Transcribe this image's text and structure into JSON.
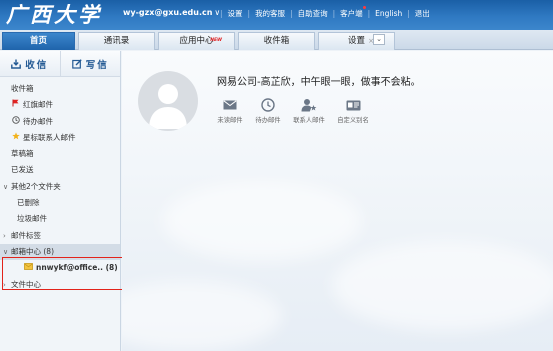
{
  "header": {
    "logo_text": "广西大学",
    "account": "wy-gzx@gxu.edu.cn",
    "account_caret": "∨",
    "links": [
      "设置",
      "我的客服",
      "自助查询",
      "客户端",
      "English",
      "退出"
    ]
  },
  "tabs": [
    {
      "label": "首页",
      "active": true
    },
    {
      "label": "通讯录"
    },
    {
      "label": "应用中心",
      "badge": "NEW"
    },
    {
      "label": "收件箱"
    },
    {
      "label": "设置",
      "close": "×"
    }
  ],
  "sidebar": {
    "receive_label": "收信",
    "compose_label": "写信",
    "items": [
      {
        "label": "收件箱"
      },
      {
        "label": "红旗邮件",
        "icon": "flag-icon"
      },
      {
        "label": "待办邮件",
        "icon": "clock-icon"
      },
      {
        "label": "星标联系人邮件",
        "icon": "star-icon"
      },
      {
        "label": "草稿箱"
      },
      {
        "label": "已发送"
      },
      {
        "label": "其他2个文件夹",
        "chevron": "∨"
      },
      {
        "label": "已删除"
      },
      {
        "label": "垃圾邮件"
      },
      {
        "label": "邮件标签",
        "chevron": "›"
      },
      {
        "label": "邮箱中心 (8)",
        "chevron": "∨"
      },
      {
        "label": "nnwykf@office.. (8)",
        "icon": "mailbox-icon"
      },
      {
        "label": "文件中心",
        "chevron": "›"
      }
    ]
  },
  "main": {
    "greeting": "网易公司-高芷欣，中午眼一眼，做事不会粘。",
    "quick_actions": [
      {
        "label": "未读邮件",
        "icon": "envelope-icon"
      },
      {
        "label": "待办邮件",
        "icon": "clock-icon"
      },
      {
        "label": "联系人邮件",
        "icon": "contact-star-icon"
      },
      {
        "label": "自定义别名",
        "icon": "id-card-icon"
      }
    ]
  }
}
